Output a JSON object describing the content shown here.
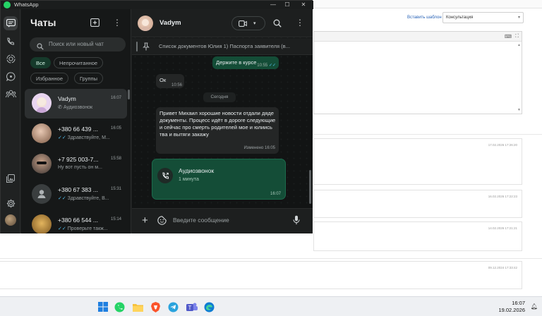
{
  "window": {
    "title": "WhatsApp"
  },
  "sidebar": {
    "title": "Чаты"
  },
  "search": {
    "placeholder": "Поиск или новый чат"
  },
  "filters": [
    "Все",
    "Непрочитанное",
    "Избранное",
    "Группы"
  ],
  "chats": [
    {
      "name": "Vadym",
      "time": "16:07",
      "preview": "Аудиозвонок",
      "ticks": ""
    },
    {
      "name": "+380 66 439 ...",
      "time": "16:05",
      "preview": "Здравствуйте, М...",
      "ticks": "✓✓"
    },
    {
      "name": "+7 925 003-7...",
      "time": "15:58",
      "preview": "Ну вот пусть он м...",
      "ticks": ""
    },
    {
      "name": "+380 67 383 ...",
      "time": "15:31",
      "preview": "Здравствуйте, В...",
      "ticks": "✓✓"
    },
    {
      "name": "+380 66 544 ...",
      "time": "15:14",
      "preview": "Проверьте такж...",
      "ticks": "✓✓"
    }
  ],
  "conversation": {
    "name": "Vadym",
    "pinned": "Список документов Юлия 1) Паспорта заявителя (в...",
    "messages": [
      {
        "text": "Держите в курсе",
        "time": "10:55",
        "ticks": "✓✓"
      },
      {
        "text": "Ок",
        "time": "10:56"
      },
      {
        "text": "Привет Михаил хорошие новости отдали дяде документы. Процесс идёт в дороге следующие и сейчас про смерть родителей мое и юлиись тва и вытяги закажу",
        "time": "Изменено 16:05"
      }
    ],
    "date_divider": "Сегодня",
    "call": {
      "title": "Аудиозвонок",
      "duration": "1 минута",
      "time": "16:07"
    },
    "compose_placeholder": "Введите сообщение"
  },
  "background_app": {
    "insert_template": "Вставить шаблон",
    "select_value": "Консультация",
    "timestamps": [
      "17.02.2026 17:26:20",
      "16.02.2026 17:22:23",
      "14.02.2026 17:21:21",
      "09.12.2024 17:33:42"
    ]
  },
  "taskbar": {
    "time": "16:07",
    "date": "19.02.2026"
  },
  "colors": {
    "accent": "#25d366",
    "outgoing": "#144d37",
    "incoming": "#242626",
    "read_ticks": "#53bdeb"
  }
}
